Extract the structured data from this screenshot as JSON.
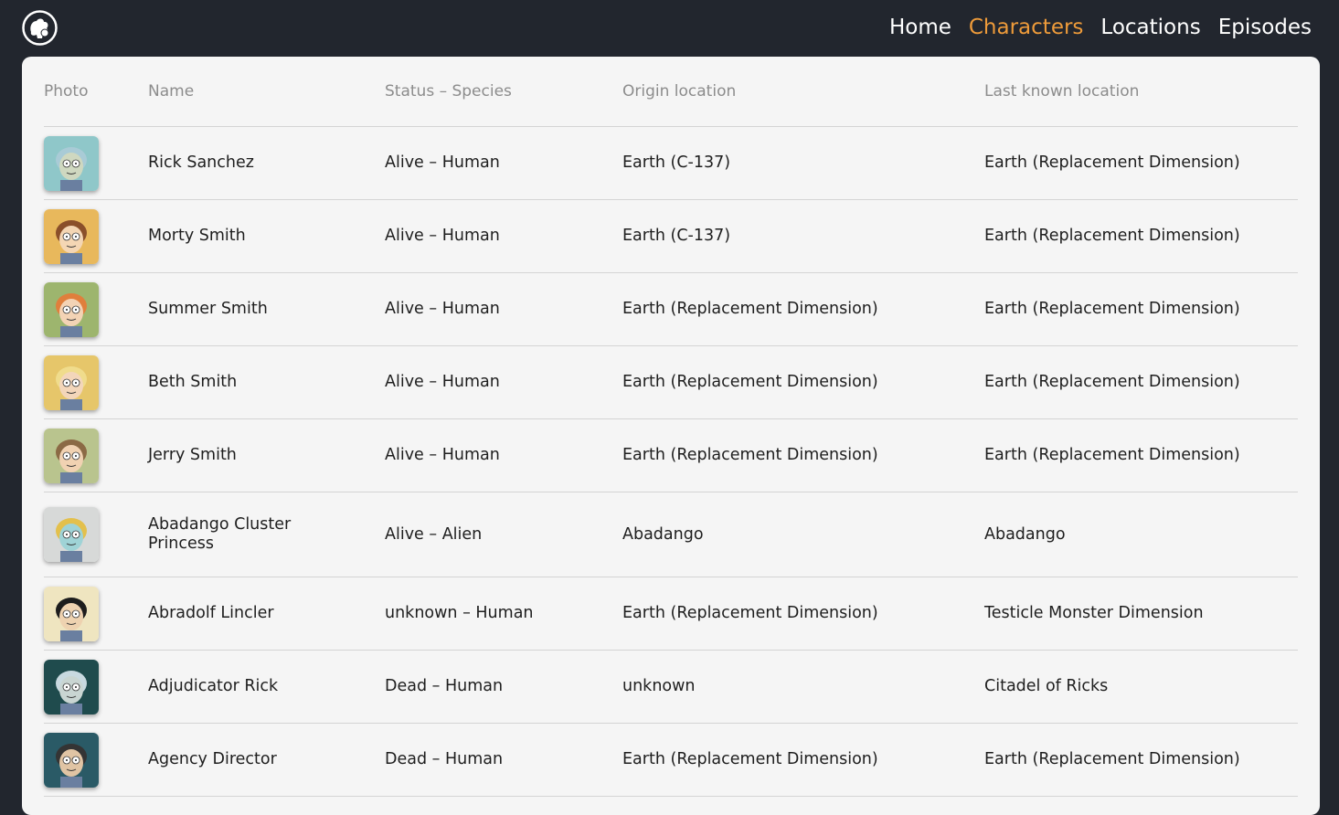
{
  "nav": {
    "items": [
      {
        "label": "Home",
        "active": false
      },
      {
        "label": "Characters",
        "active": true
      },
      {
        "label": "Locations",
        "active": false
      },
      {
        "label": "Episodes",
        "active": false
      }
    ],
    "accent_color": "#ee9b3a"
  },
  "table": {
    "headers": {
      "photo": "Photo",
      "name": "Name",
      "status_species": "Status – Species",
      "origin": "Origin location",
      "last_known": "Last known location"
    },
    "rows": [
      {
        "name": "Rick Sanchez",
        "status_species": "Alive – Human",
        "origin": "Earth (C-137)",
        "last_known": "Earth (Replacement Dimension)",
        "photo_bg": "#8fc7c9",
        "skin": "#cfd8c0",
        "hair": "#a9cbd6"
      },
      {
        "name": "Morty Smith",
        "status_species": "Alive – Human",
        "origin": "Earth (C-137)",
        "last_known": "Earth (Replacement Dimension)",
        "photo_bg": "#e8b85c",
        "skin": "#f4d6b4",
        "hair": "#8a4f2a"
      },
      {
        "name": "Summer Smith",
        "status_species": "Alive – Human",
        "origin": "Earth (Replacement Dimension)",
        "last_known": "Earth (Replacement Dimension)",
        "photo_bg": "#9db56e",
        "skin": "#f3d3b5",
        "hair": "#e07f3c"
      },
      {
        "name": "Beth Smith",
        "status_species": "Alive – Human",
        "origin": "Earth (Replacement Dimension)",
        "last_known": "Earth (Replacement Dimension)",
        "photo_bg": "#e6c66a",
        "skin": "#f3d6ba",
        "hair": "#f0dc8c"
      },
      {
        "name": "Jerry Smith",
        "status_species": "Alive – Human",
        "origin": "Earth (Replacement Dimension)",
        "last_known": "Earth (Replacement Dimension)",
        "photo_bg": "#b9c48e",
        "skin": "#f1d2b2",
        "hair": "#8b6a45"
      },
      {
        "name": "Abadango Cluster Princess",
        "status_species": "Alive – Alien",
        "origin": "Abadango",
        "last_known": "Abadango",
        "photo_bg": "#d7d9d8",
        "skin": "#9fd3d6",
        "hair": "#e3c04c"
      },
      {
        "name": "Abradolf Lincler",
        "status_species": "unknown – Human",
        "origin": "Earth (Replacement Dimension)",
        "last_known": "Testicle Monster Dimension",
        "photo_bg": "#efe5c0",
        "skin": "#eed2b0",
        "hair": "#1d1d1d"
      },
      {
        "name": "Adjudicator Rick",
        "status_species": "Dead – Human",
        "origin": "unknown",
        "last_known": "Citadel of Ricks",
        "photo_bg": "#1f4b4d",
        "skin": "#c9d5d2",
        "hair": "#c8d9e0"
      },
      {
        "name": "Agency Director",
        "status_species": "Dead – Human",
        "origin": "Earth (Replacement Dimension)",
        "last_known": "Earth (Replacement Dimension)",
        "photo_bg": "#2a5a66",
        "skin": "#e0c4a4",
        "hair": "#343434"
      }
    ]
  }
}
